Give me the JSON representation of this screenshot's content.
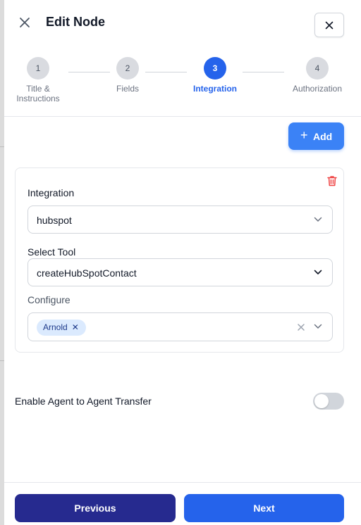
{
  "header": {
    "title": "Edit Node",
    "close_icon": "close-icon"
  },
  "stepper": {
    "steps": [
      {
        "number": "1",
        "label": "Title &\nInstructions",
        "active": false
      },
      {
        "number": "2",
        "label": "Fields",
        "active": false
      },
      {
        "number": "3",
        "label": "Integration",
        "active": true
      },
      {
        "number": "4",
        "label": "Authorization",
        "active": false
      }
    ]
  },
  "toolbar": {
    "add_label": "Add"
  },
  "integration_card": {
    "integration_label": "Integration",
    "integration_value": "hubspot",
    "tool_label": "Select Tool",
    "tool_value": "createHubSpotContact",
    "configure_label": "Configure",
    "configure_chips": [
      "Arnold"
    ]
  },
  "transfer": {
    "label": "Enable Agent to Agent Transfer",
    "enabled": false
  },
  "footer": {
    "previous_label": "Previous",
    "next_label": "Next"
  },
  "colors": {
    "primary": "#2563eb",
    "previous": "#262a8f",
    "danger": "#ef4444"
  }
}
